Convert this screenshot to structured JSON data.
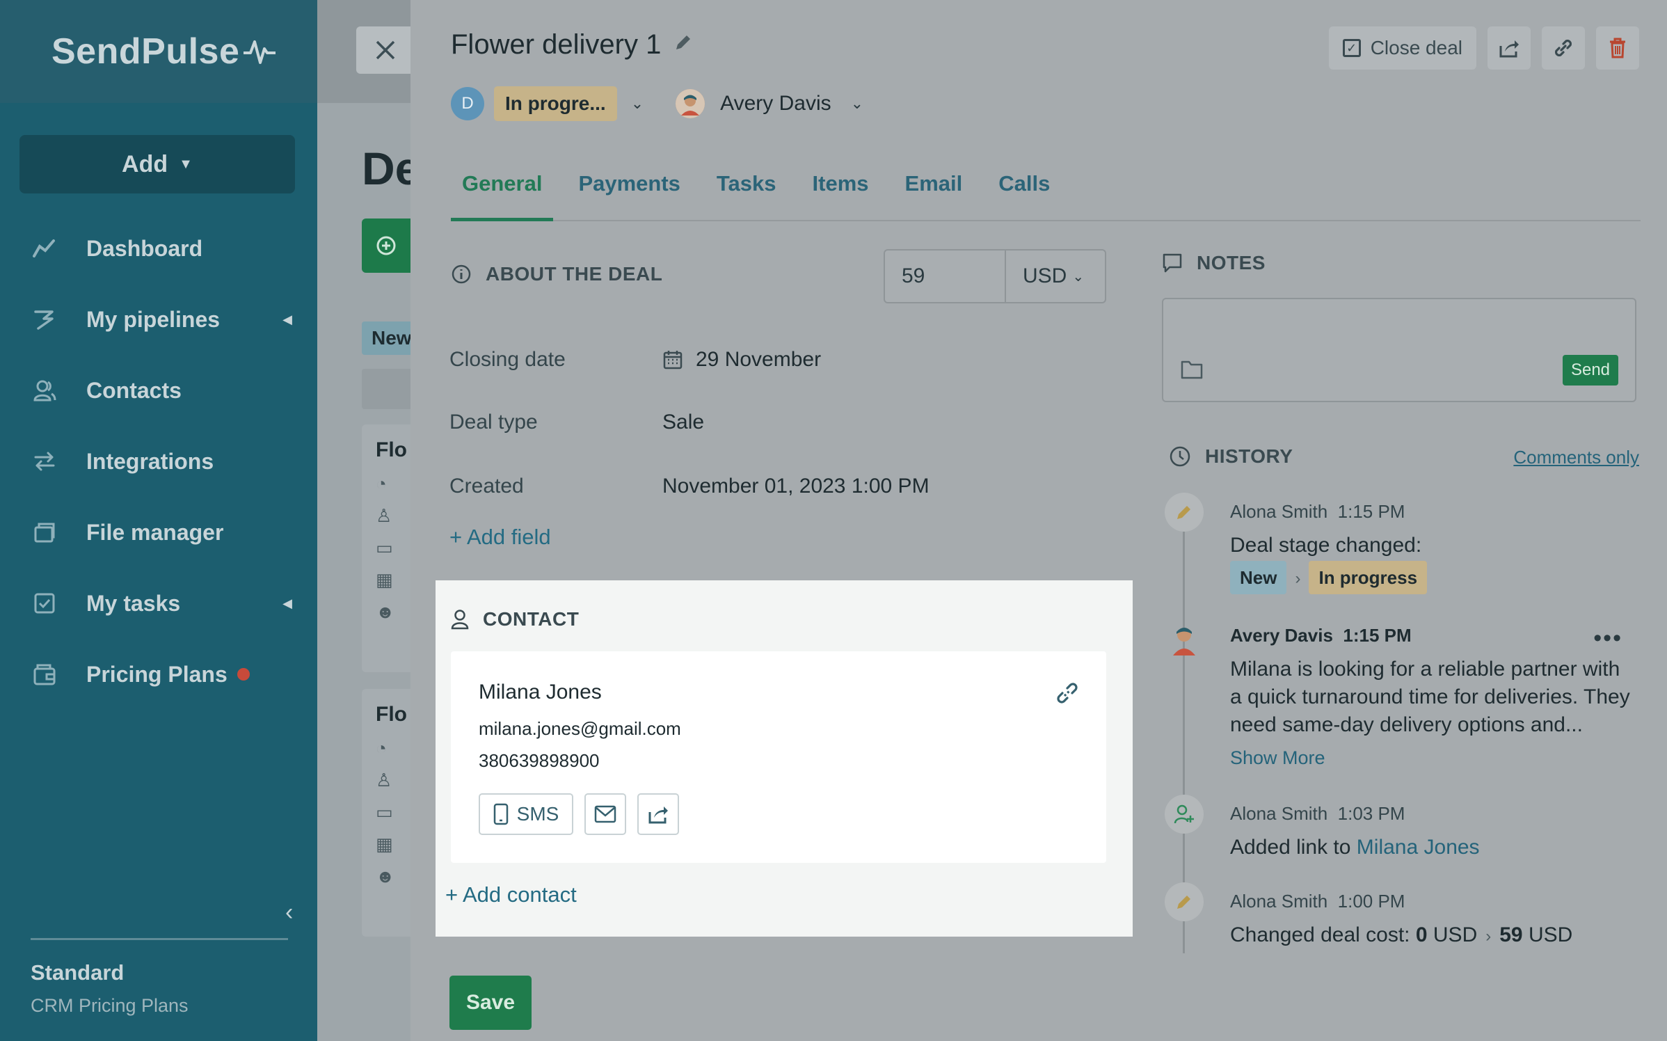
{
  "sidebar": {
    "logo": "SendPulse",
    "add_label": "Add",
    "items": [
      {
        "label": "Dashboard",
        "icon": "chart-line-icon"
      },
      {
        "label": "My pipelines",
        "icon": "pipelines-icon"
      },
      {
        "label": "Contacts",
        "icon": "contacts-icon"
      },
      {
        "label": "Integrations",
        "icon": "integrations-icon"
      },
      {
        "label": "File manager",
        "icon": "file-manager-icon"
      },
      {
        "label": "My tasks",
        "icon": "tasks-icon"
      },
      {
        "label": "Pricing Plans",
        "icon": "pricing-icon"
      }
    ],
    "plan_title": "Standard",
    "plan_subtitle": "CRM Pricing Plans"
  },
  "background": {
    "title": "De",
    "chip": "New",
    "card1_title": "Flo",
    "card2_title": "Flo"
  },
  "deal": {
    "title": "Flower delivery 1",
    "close_deal_label": "Close deal",
    "pipeline_letter": "D",
    "stage": "In progre...",
    "owner": "Avery Davis"
  },
  "tabs": [
    "General",
    "Payments",
    "Tasks",
    "Items",
    "Email",
    "Calls"
  ],
  "about": {
    "heading": "ABOUT THE DEAL",
    "cost_value": "59",
    "currency": "USD",
    "fields": [
      {
        "label": "Closing date",
        "value": "29 November"
      },
      {
        "label": "Deal type",
        "value": "Sale"
      },
      {
        "label": "Created",
        "value": "November 01, 2023 1:00 PM"
      }
    ],
    "add_field": "+ Add field"
  },
  "contact": {
    "heading": "CONTACT",
    "name": "Milana Jones",
    "email": "milana.jones@gmail.com",
    "phone": "380639898900",
    "sms_label": "SMS",
    "add_contact": "+ Add contact"
  },
  "save_label": "Save",
  "notes": {
    "heading": "NOTES",
    "send_label": "Send"
  },
  "history": {
    "heading": "HISTORY",
    "filter_label": "Comments only",
    "entries": [
      {
        "author": "Alona Smith",
        "time": "1:15 PM",
        "text": "Deal stage changed:",
        "from": "New",
        "to": "In progress"
      },
      {
        "author": "Avery Davis",
        "time": "1:15 PM",
        "line1": "Milana is looking for a reliable partner with",
        "line2": "a quick turnaround time for deliveries. They",
        "line3": "need same-day delivery options and...",
        "show_more": "Show More"
      },
      {
        "author": "Alona Smith",
        "time": "1:03 PM",
        "text": "Added link to ",
        "link": "Milana Jones"
      },
      {
        "author": "Alona Smith",
        "time": "1:00 PM",
        "text": "Changed deal cost: ",
        "old_value": "0",
        "old_currency": "USD",
        "new_value": "59",
        "new_currency": "USD"
      }
    ]
  },
  "colors": {
    "sidebar": "#1c5e6f",
    "accent_green": "#1f7c4c",
    "link": "#246b83",
    "stage_chip": "#c6b389"
  }
}
